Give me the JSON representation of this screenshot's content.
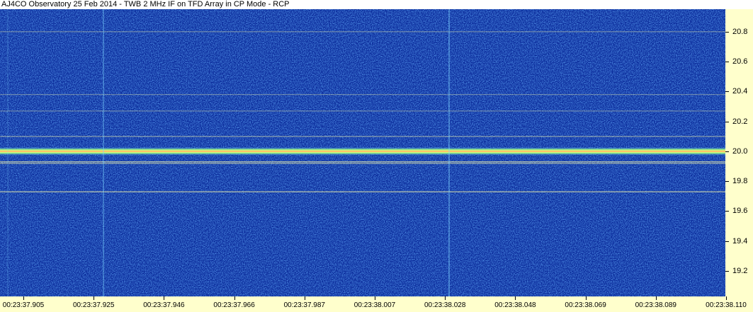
{
  "chart_data": {
    "type": "heatmap",
    "title": "AJ4CO Observatory 25 Feb 2014 - TWB 2 MHz IF on TFD Array in CP Mode - RCP",
    "xlabel": "",
    "ylabel": "",
    "x_ticks": [
      "00:23:37.905",
      "00:23:37.925",
      "00:23:37.946",
      "00:23:37.966",
      "00:23:37.987",
      "00:23:38.007",
      "00:23:38.028",
      "00:23:38.048",
      "00:23:38.069",
      "00:23:38.089",
      "00:23:38.110"
    ],
    "y_ticks": [
      19.2,
      19.4,
      19.6,
      19.8,
      20.0,
      20.2,
      20.4,
      20.6,
      20.8
    ],
    "ylim": [
      19.03,
      20.95
    ],
    "colors": {
      "background": "#0a2a9a",
      "noise": "#2f6fe0",
      "line": "#ffffaa",
      "carrier_core": "#ff3030"
    },
    "carriers": [
      {
        "freq": 20.0,
        "strength": 1.0
      },
      {
        "freq": 19.93,
        "strength": 0.5
      },
      {
        "freq": 19.92,
        "strength": 0.35
      },
      {
        "freq": 19.73,
        "strength": 0.45
      },
      {
        "freq": 20.1,
        "strength": 0.25
      },
      {
        "freq": 20.8,
        "strength": 0.12
      },
      {
        "freq": 20.38,
        "strength": 0.1
      },
      {
        "freq": 20.27,
        "strength": 0.1
      }
    ]
  }
}
